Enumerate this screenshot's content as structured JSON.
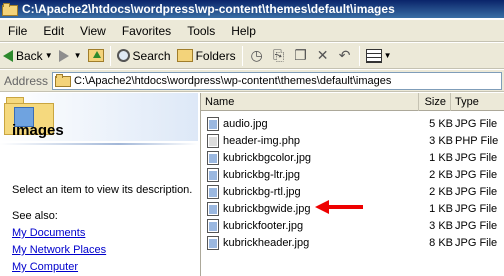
{
  "window": {
    "title": "C:\\Apache2\\htdocs\\wordpress\\wp-content\\themes\\default\\images"
  },
  "menu": [
    "File",
    "Edit",
    "View",
    "Favorites",
    "Tools",
    "Help"
  ],
  "toolbar": {
    "back_label": "Back",
    "search_label": "Search",
    "folders_label": "Folders"
  },
  "address": {
    "label": "Address",
    "value": "C:\\Apache2\\htdocs\\wordpress\\wp-content\\themes\\default\\images"
  },
  "left_pane": {
    "folder_name": "images",
    "hint": "Select an item to view its description.",
    "see_also": "See also:",
    "links": [
      "My Documents",
      "My Network Places",
      "My Computer"
    ]
  },
  "columns": {
    "name": "Name",
    "size": "Size",
    "type": "Type"
  },
  "files": [
    {
      "name": "audio.jpg",
      "size": "5 KB",
      "type": "JPG File"
    },
    {
      "name": "header-img.php",
      "size": "3 KB",
      "type": "PHP File"
    },
    {
      "name": "kubrickbgcolor.jpg",
      "size": "1 KB",
      "type": "JPG File"
    },
    {
      "name": "kubrickbg-ltr.jpg",
      "size": "2 KB",
      "type": "JPG File"
    },
    {
      "name": "kubrickbg-rtl.jpg",
      "size": "2 KB",
      "type": "JPG File"
    },
    {
      "name": "kubrickbgwide.jpg",
      "size": "1 KB",
      "type": "JPG File"
    },
    {
      "name": "kubrickfooter.jpg",
      "size": "3 KB",
      "type": "JPG File"
    },
    {
      "name": "kubrickheader.jpg",
      "size": "8 KB",
      "type": "JPG File"
    }
  ],
  "colors": {
    "title_bar": "#0a246a",
    "chrome": "#ece9d8",
    "link": "#0000cc",
    "annotation_arrow": "#ee0000"
  }
}
